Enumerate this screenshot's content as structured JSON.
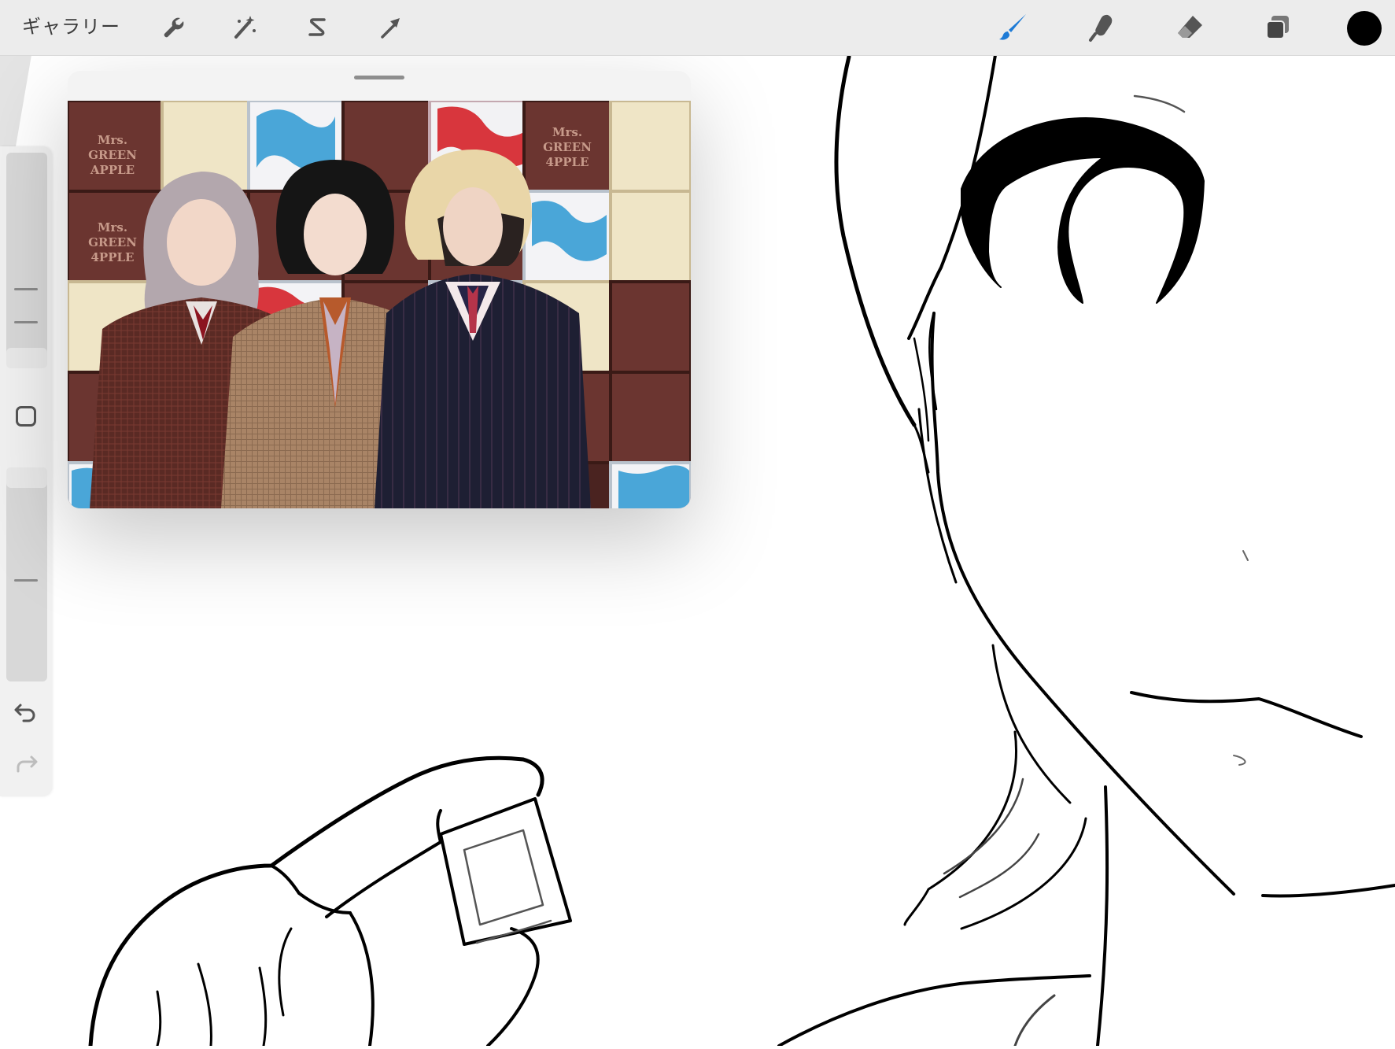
{
  "toolbar": {
    "gallery_label": "ギャラリー",
    "left_tools": [
      {
        "name": "actions",
        "icon": "wrench-icon"
      },
      {
        "name": "adjustments",
        "icon": "magic-wand-icon"
      },
      {
        "name": "selection",
        "icon": "selection-s-icon"
      },
      {
        "name": "transform",
        "icon": "arrow-cursor-icon"
      }
    ],
    "right_tools": [
      {
        "name": "paint",
        "icon": "brush-icon",
        "active": true
      },
      {
        "name": "smudge",
        "icon": "smudge-finger-icon"
      },
      {
        "name": "erase",
        "icon": "eraser-icon"
      },
      {
        "name": "layers",
        "icon": "layers-icon"
      }
    ],
    "current_color": "#000000",
    "active_tool_color": "#1e7bd6"
  },
  "sidebar": {
    "brush_size_slider": {
      "icon": "size-slider"
    },
    "modify_button": {
      "icon": "square-icon"
    },
    "opacity_slider": {
      "icon": "opacity-slider"
    },
    "undo": {
      "icon": "undo-icon"
    },
    "redo": {
      "icon": "redo-icon",
      "enabled": false
    }
  },
  "reference": {
    "chocolate_labels": [
      "Mrs.",
      "GREEN",
      "APPLE"
    ],
    "chocolate_labels_alt": [
      "Mrs.",
      "GREEN",
      "4PPLE"
    ]
  }
}
